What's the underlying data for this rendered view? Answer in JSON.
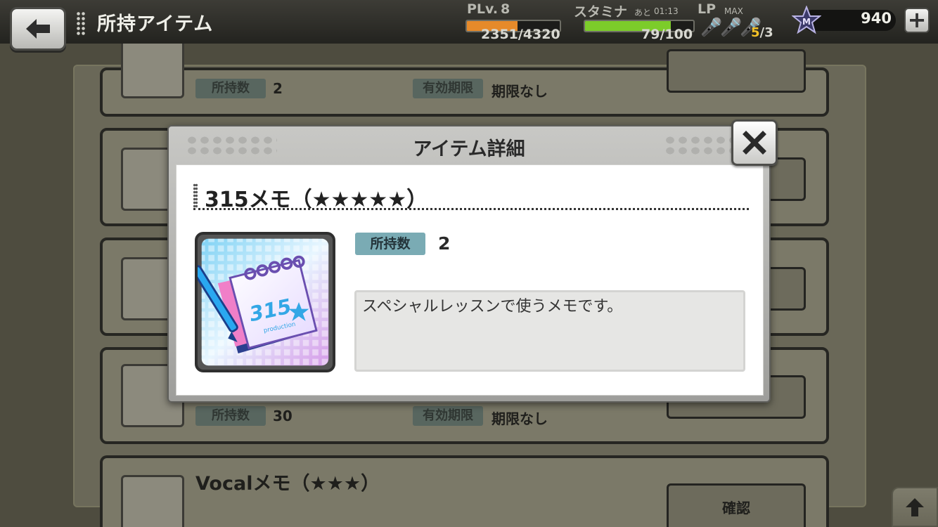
{
  "header": {
    "title": "所持アイテム",
    "plv_label": "PLv.",
    "plv_value": "8",
    "exp_text": "2351/4320",
    "exp_ratio": 0.544,
    "stamina_label": "スタミナ",
    "stamina_timer_prefix": "あと",
    "stamina_timer": "01:13",
    "stamina_text": "79/100",
    "stamina_ratio": 0.79,
    "lp_label": "LP",
    "lp_max_label": "MAX",
    "lp_current": "5",
    "lp_total": "/3",
    "money_value": "940",
    "plus_label": "+"
  },
  "list": {
    "owned_label": "所持数",
    "expiry_label": "有効期限",
    "expiry_value": "期限なし",
    "item1_owned": "2",
    "item4_owned": "30",
    "item5_title": "Vocalメモ（★★★）",
    "confirm_label": "確認"
  },
  "modal": {
    "title": "アイテム詳細",
    "item_name": "315メモ（★★★★★）",
    "owned_label": "所持数",
    "owned_value": "2",
    "description": "スペシャルレッスンで使うメモです。",
    "icon_logo_text": "315",
    "icon_small_text": "production"
  },
  "icons": {
    "back": "back-arrow-icon",
    "close": "close-x-icon",
    "money": "star-m-icon",
    "lp": "microphone-icon",
    "scroll_up": "up-arrow-icon"
  },
  "colors": {
    "exp_bar": "#e68a2a",
    "stamina_bar": "#7ccc2a",
    "owned_tag": "#7aabb4",
    "lp_current": "#f3c227"
  }
}
